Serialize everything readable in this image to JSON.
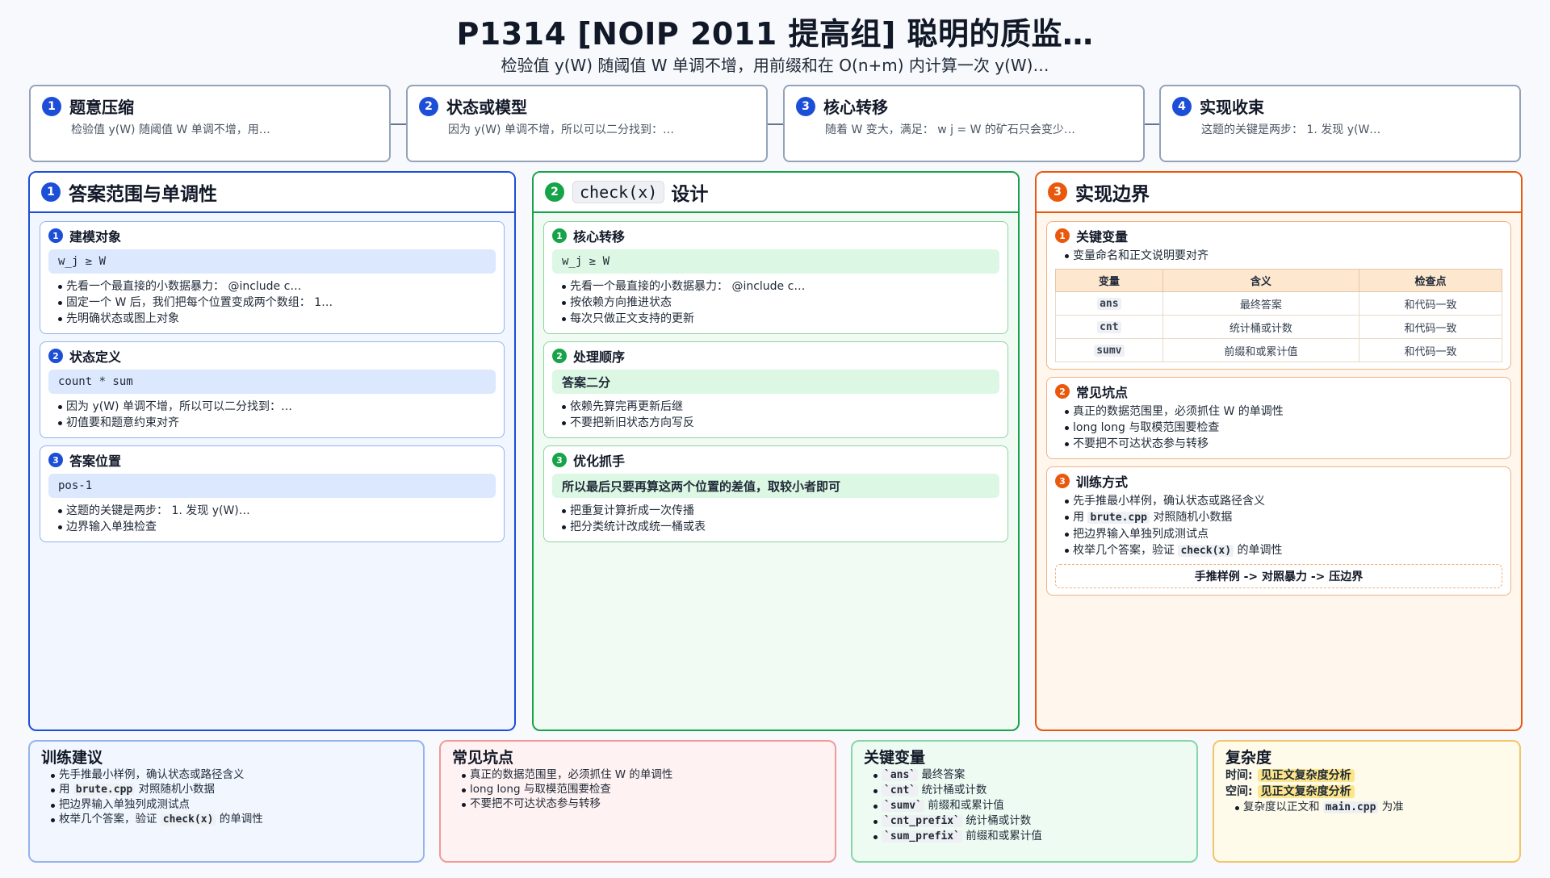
{
  "header": {
    "title": "P1314 [NOIP 2011 提高组] 聪明的质监…",
    "subtitle": "检验值 y(W) 随阈值 W 单调不增，用前缀和在 O(n+m) 内计算一次 y(W)…"
  },
  "steps": [
    {
      "num": "1",
      "title": "题意压缩",
      "desc": "检验值 y(W) 随阈值 W 单调不增，用…"
    },
    {
      "num": "2",
      "title": "状态或模型",
      "desc": "因为 y(W) 单调不增，所以可以二分找到：…"
    },
    {
      "num": "3",
      "title": "核心转移",
      "desc": "随着 W 变大，满足： w j = W 的矿石只会变少…"
    },
    {
      "num": "4",
      "title": "实现收束",
      "desc": "这题的关键是两步： 1. 发现 y(W…"
    }
  ],
  "col1": {
    "num": "1",
    "title": "答案范围与单调性",
    "cards": [
      {
        "num": "1",
        "title": "建模对象",
        "highlight": "w_j ≥ W",
        "bullets": [
          "先看一个最直接的小数据暴力： @include c…",
          "固定一个 W 后，我们把每个位置变成两个数组： 1…",
          "先明确状态或图上对象"
        ]
      },
      {
        "num": "2",
        "title": "状态定义",
        "highlight": "count * sum",
        "bullets": [
          "因为 y(W) 单调不增，所以可以二分找到：…",
          "初值要和题意约束对齐"
        ]
      },
      {
        "num": "3",
        "title": "答案位置",
        "highlight": "pos-1",
        "bullets": [
          "这题的关键是两步： 1. 发现 y(W)…",
          "边界输入单独检查"
        ]
      }
    ]
  },
  "col2": {
    "num": "2",
    "title_code": "check(x)",
    "title": "设计",
    "cards": [
      {
        "num": "1",
        "title": "核心转移",
        "highlight": "w_j ≥ W",
        "bullets": [
          "先看一个最直接的小数据暴力： @include c…",
          "按依赖方向推进状态",
          "每次只做正文支持的更新"
        ]
      },
      {
        "num": "2",
        "title": "处理顺序",
        "highlight": "答案二分",
        "bullets": [
          "依赖先算完再更新后继",
          "不要把新旧状态方向写反"
        ]
      },
      {
        "num": "3",
        "title": "优化抓手",
        "highlight": "所以最后只要再算这两个位置的差值，取较小者即可",
        "bullets": [
          "把重复计算折成一次传播",
          "把分类统计改成统一桶或表"
        ]
      }
    ]
  },
  "col3": {
    "num": "3",
    "title": "实现边界",
    "card1": {
      "num": "1",
      "title": "关键变量",
      "bullet": "变量命名和正文说明要对齐",
      "headers": [
        "变量",
        "含义",
        "检查点"
      ],
      "rows": [
        [
          "ans",
          "最终答案",
          "和代码一致"
        ],
        [
          "cnt",
          "统计桶或计数",
          "和代码一致"
        ],
        [
          "sumv",
          "前缀和或累计值",
          "和代码一致"
        ]
      ]
    },
    "card2": {
      "num": "2",
      "title": "常见坑点",
      "bullets": [
        "真正的数据范围里，必须抓住 W 的单调性",
        "long long 与取模范围要检查",
        "不要把不可达状态参与转移"
      ]
    },
    "card3": {
      "num": "3",
      "title": "训练方式",
      "b1": "先手推最小样例，确认状态或路径含义",
      "b2_pre": "用",
      "b2_code": "brute.cpp",
      "b2_post": "对照随机小数据",
      "b3": "把边界输入单独列成测试点",
      "b4_pre": "枚举几个答案，验证",
      "b4_code": "check(x)",
      "b4_post": "的单调性",
      "flow": "手推样例 -> 对照暴力 -> 压边界"
    }
  },
  "bottom": {
    "train": {
      "title": "训练建议",
      "b1": "先手推最小样例，确认状态或路径含义",
      "b2_pre": "用",
      "b2_code": "brute.cpp",
      "b2_post": "对照随机小数据",
      "b3": "把边界输入单独列成测试点",
      "b4_pre": "枚举几个答案，验证",
      "b4_code": "check(x)",
      "b4_post": "的单调性"
    },
    "pitfalls": {
      "title": "常见坑点",
      "bullets": [
        "真正的数据范围里，必须抓住 W 的单调性",
        "long long 与取模范围要检查",
        "不要把不可达状态参与转移"
      ]
    },
    "vars": {
      "title": "关键变量",
      "items": [
        {
          "code": "`ans`",
          "desc": "最终答案"
        },
        {
          "code": "`cnt`",
          "desc": "统计桶或计数"
        },
        {
          "code": "`sumv`",
          "desc": "前缀和或累计值"
        },
        {
          "code": "`cnt_prefix`",
          "desc": "统计桶或计数"
        },
        {
          "code": "`sum_prefix`",
          "desc": "前缀和或累计值"
        }
      ]
    },
    "complexity": {
      "title": "复杂度",
      "time_label": "时间:",
      "time_value": "见正文复杂度分析",
      "space_label": "空间:",
      "space_value": "见正文复杂度分析",
      "note_pre": "复杂度以正文和",
      "note_code": "main.cpp",
      "note_post": "为准"
    }
  },
  "colors": {
    "blue": "#1d4ed8",
    "green": "#16a34a",
    "orange": "#ea580c",
    "red": "#f09a9a",
    "yellow": "#f3c56b"
  }
}
